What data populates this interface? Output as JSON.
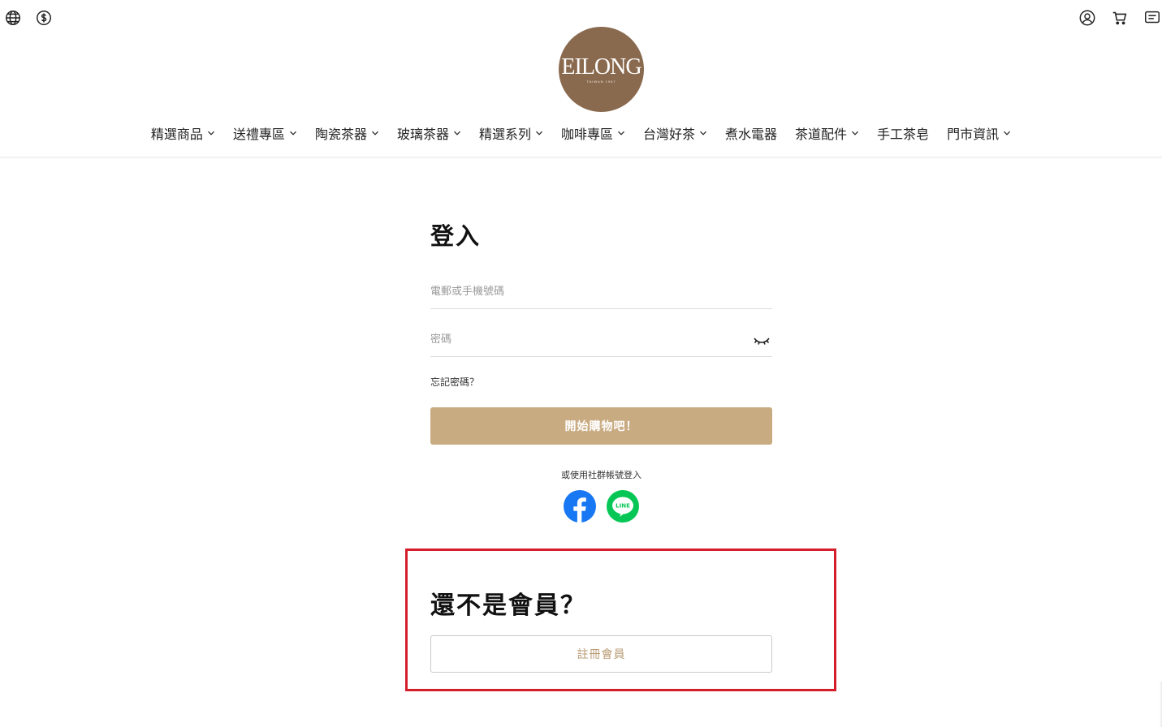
{
  "topbar": {
    "left_icons": [
      "globe-icon",
      "currency-icon"
    ],
    "right_icons": [
      "user-icon",
      "cart-icon",
      "message-icon"
    ]
  },
  "logo": {
    "text": "EILONG",
    "subtext": "TAIWAN 1987"
  },
  "nav": {
    "items": [
      {
        "label": "精選商品",
        "dropdown": true
      },
      {
        "label": "送禮專區",
        "dropdown": true
      },
      {
        "label": "陶瓷茶器",
        "dropdown": true
      },
      {
        "label": "玻璃茶器",
        "dropdown": true
      },
      {
        "label": "精選系列",
        "dropdown": true
      },
      {
        "label": "咖啡專區",
        "dropdown": true
      },
      {
        "label": "台灣好茶",
        "dropdown": true
      },
      {
        "label": "煮水電器",
        "dropdown": false
      },
      {
        "label": "茶道配件",
        "dropdown": true
      },
      {
        "label": "手工茶皂",
        "dropdown": false
      },
      {
        "label": "門市資訊",
        "dropdown": true
      }
    ]
  },
  "login": {
    "title": "登入",
    "account_placeholder": "電郵或手機號碼",
    "account_value": "",
    "password_placeholder": "密碼",
    "password_value": "",
    "forgot_label": "忘記密碼？",
    "submit_label": "開始購物吧！",
    "social_label": "或使用社群帳號登入",
    "social_icons": [
      "facebook-icon",
      "line-icon"
    ],
    "line_icon_text": "LINE"
  },
  "register": {
    "title": "還不是會員？",
    "button_label": "註冊會員"
  },
  "colors": {
    "accent": "#c9ab82",
    "logo_bg": "#8a6a4f",
    "highlight_border": "#d41f2b",
    "facebook": "#1877f2",
    "line": "#06c755"
  }
}
